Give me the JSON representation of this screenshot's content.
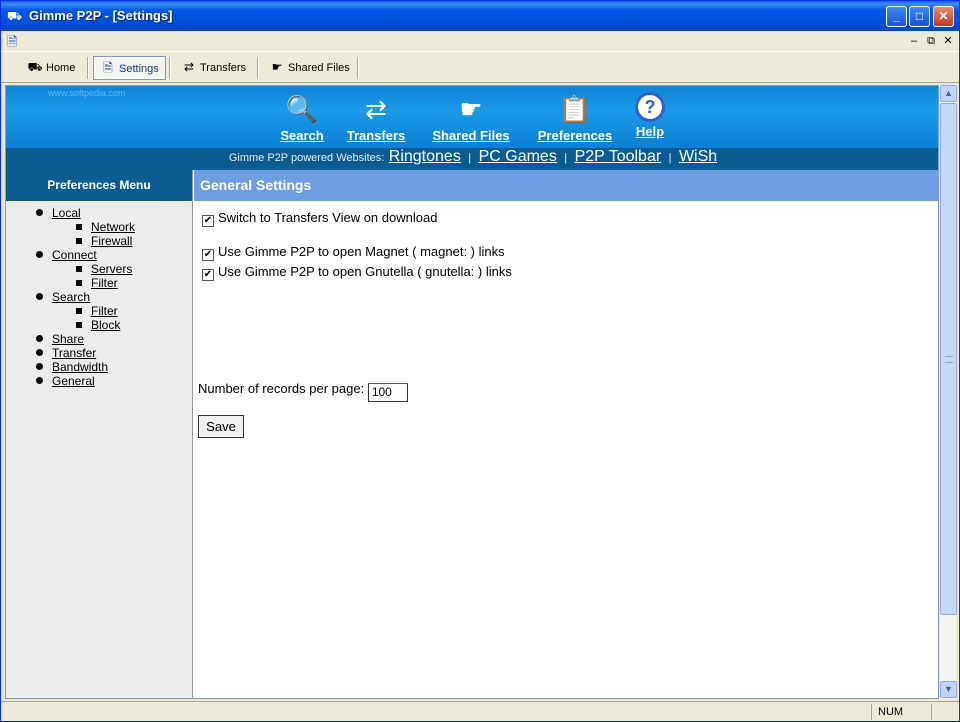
{
  "window": {
    "title": "Gimme P2P - [Settings]",
    "minimize": "_",
    "maximize": "□",
    "close": "✕"
  },
  "mdi": {
    "minimize": "–",
    "restore": "⧉",
    "close": "✕"
  },
  "toolbar": {
    "items": [
      {
        "label": "Home",
        "icon": "home-icon",
        "active": false
      },
      {
        "label": "Settings",
        "icon": "settings-icon",
        "active": true
      },
      {
        "label": "Transfers",
        "icon": "transfers-icon",
        "active": false
      },
      {
        "label": "Shared Files",
        "icon": "shared-files-icon",
        "active": false
      }
    ]
  },
  "banner": {
    "watermark": "www.softpedia.com",
    "nav": [
      {
        "label": "Search",
        "icon": "search-icon"
      },
      {
        "label": "Transfers",
        "icon": "transfers-icon"
      },
      {
        "label": "Shared Files",
        "icon": "shared-files-icon"
      },
      {
        "label": "Preferences",
        "icon": "preferences-icon"
      },
      {
        "label": "Help",
        "icon": "help-icon",
        "glyph": "?"
      }
    ]
  },
  "sites": {
    "lead": "Gimme P2P powered Websites:",
    "links": [
      "Ringtones",
      "PC Games",
      "P2P Toolbar",
      "WiSh"
    ]
  },
  "prefs_menu": {
    "title": "Preferences Menu",
    "items": {
      "local": "Local",
      "network": "Network",
      "firewall": "Firewall",
      "connect": "Connect",
      "servers": "Servers",
      "filter1": "Filter",
      "search": "Search",
      "filter2": "Filter",
      "block": "Block",
      "share": "Share",
      "transfer": "Transfer",
      "bandwidth": "Bandwidth",
      "general": "General"
    }
  },
  "general": {
    "title": "General Settings",
    "switch_label": "Switch to Transfers View on download",
    "magnet_label": "Use Gimme P2P to open Magnet ( magnet: ) links",
    "gnutella_label": "Use Gimme P2P to open Gnutella ( gnutella: ) links",
    "checked_mark": "✔",
    "records_label": "Number of records per page:",
    "records_value": "100",
    "save_label": "Save"
  },
  "status": {
    "num": "NUM"
  },
  "colors": {
    "banner": "#1A9BE8",
    "dark_blue": "#0B5C93",
    "section_header": "#6E9DE2"
  }
}
